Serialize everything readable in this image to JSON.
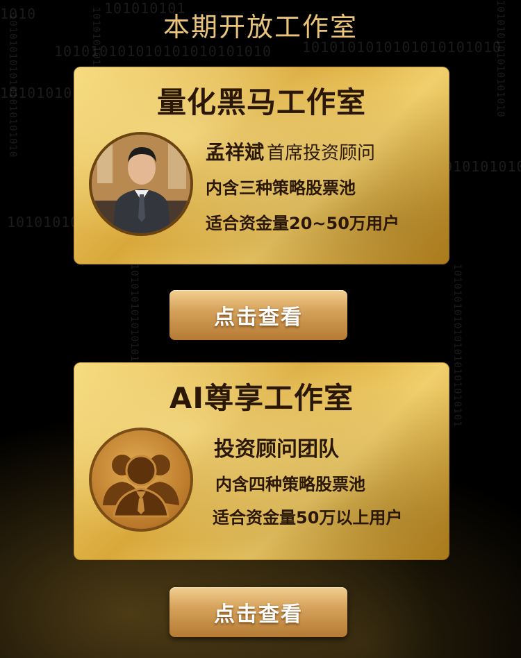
{
  "page": {
    "title": "本期开放工作室"
  },
  "background": {
    "binary_rows": [
      "1010",
      "101010101010101010101010",
      "1010101010101010101010",
      "1010101010101010101010",
      "1010101010",
      "101010101010",
      "101010101"
    ],
    "binary_cols": [
      "1010101010101010101010",
      "1010101010101010",
      "1010101010101010101010101010",
      "101010101010101010",
      "1010101010101010101010101"
    ]
  },
  "studios": [
    {
      "title": "量化黑马工作室",
      "advisor_name": "孟祥斌",
      "advisor_role": "首席投资顾问",
      "line1": "内含三种策略股票池",
      "line2": "适合资金量20~50万用户",
      "button_label": "点击查看"
    },
    {
      "title": "AI尊享工作室",
      "team_label": "投资顾问团队",
      "line1": "内含四种策略股票池",
      "line2": "适合资金量50万以上用户",
      "button_label": "点击查看"
    }
  ],
  "colors": {
    "background": "#000000",
    "title_gold": "#e9c47a",
    "card_gold": "#e0b44a",
    "text_dark": "#2a1706",
    "button_gold": "#d6a35c"
  },
  "icons": {
    "advisor_avatar": "advisor-photo",
    "team_avatar": "team-people-icon"
  }
}
